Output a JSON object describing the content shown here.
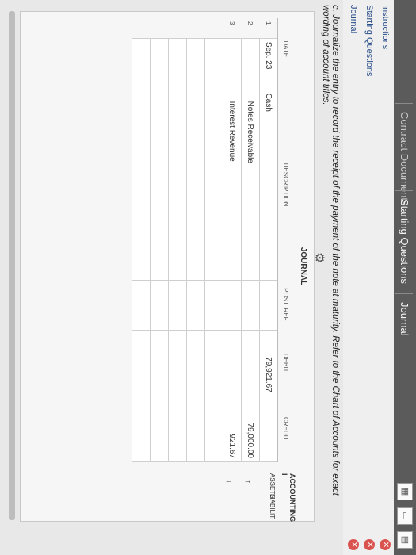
{
  "header": {
    "tabs": [
      "Instructions",
      "Starting Questions",
      "Journal"
    ],
    "faded_tab": "Contract Documents"
  },
  "nav": {
    "items": [
      "Instructions",
      "Starting Questions",
      "Journal"
    ]
  },
  "instruction": "c. Journalize the entry to record the receipt of the payment of the note at maturity. Refer to the Chart of Accounts for exact wording of account titles.",
  "journal": {
    "title": "JOURNAL",
    "headers": {
      "date": "DATE",
      "description": "DESCRIPTION",
      "post_ref": "POST. REF.",
      "debit": "DEBIT",
      "credit": "CREDIT"
    },
    "rows": [
      {
        "no": "1",
        "date": "Sep. 23",
        "description": "Cash",
        "post_ref": "",
        "debit": "79,921.67",
        "credit": ""
      },
      {
        "no": "2",
        "date": "",
        "description": "Notes Receivable",
        "post_ref": "",
        "debit": "",
        "credit": "79,000.00"
      },
      {
        "no": "3",
        "date": "",
        "description": "Interest Revenue",
        "post_ref": "",
        "debit": "",
        "credit": "921.67"
      }
    ]
  },
  "accounting_equation": {
    "title": "ACCOUNTING I",
    "col1": "ASSETS",
    "col2": "LIABILIT"
  }
}
